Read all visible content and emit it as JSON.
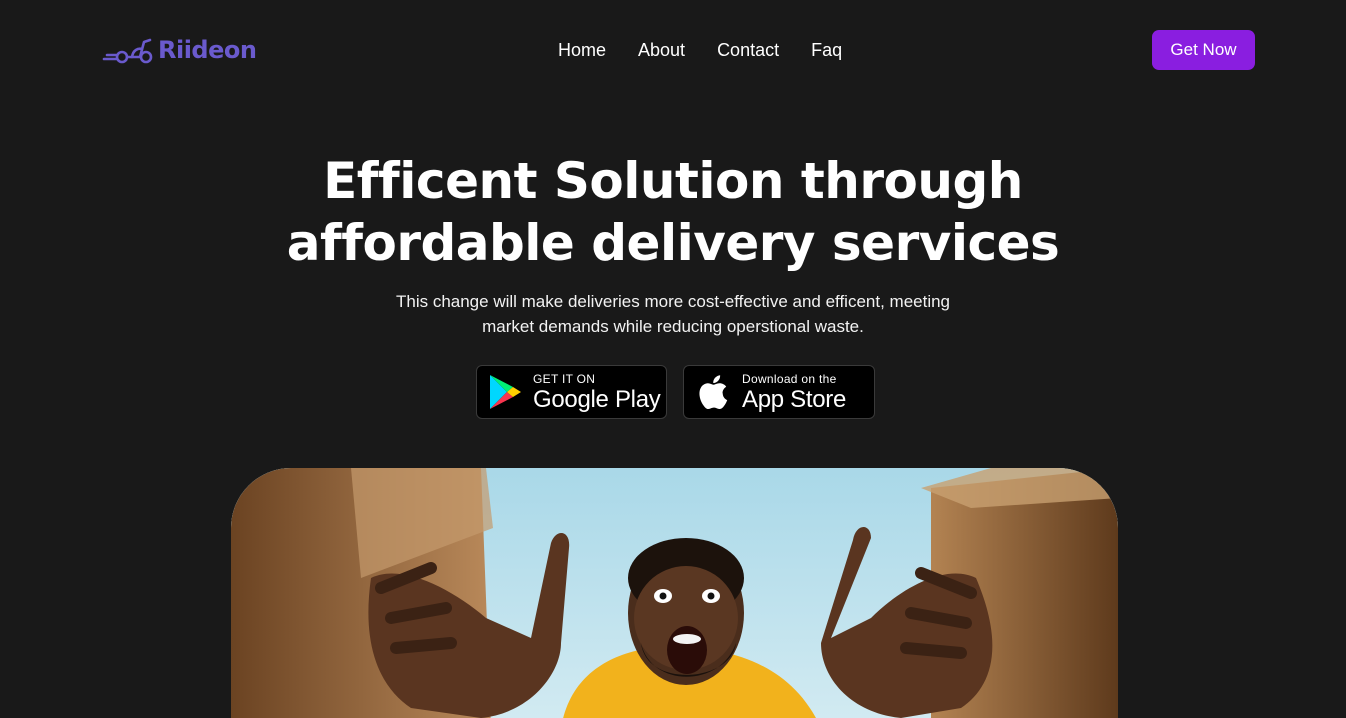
{
  "brand": {
    "name": "Riideon",
    "logo_icon": "scooter-icon",
    "accent": "#6a5acd"
  },
  "nav": {
    "items": [
      "Home",
      "About",
      "Contact",
      "Faq"
    ]
  },
  "header": {
    "cta_label": "Get Now",
    "cta_color": "#8a1ee0"
  },
  "hero": {
    "title_line1": "Efficent Solution through",
    "title_line2": "affordable delivery services",
    "subtitle_line1": "This change will make deliveries more cost-effective and efficent, meeting",
    "subtitle_line2": "market demands while reducing operstional waste."
  },
  "badges": {
    "google": {
      "small": "GET IT ON",
      "big": "Google Play",
      "icon": "google-play-icon"
    },
    "apple": {
      "small": "Download on the",
      "big": "App Store",
      "icon": "apple-icon"
    }
  },
  "colors": {
    "background": "#191919",
    "text": "#ffffff"
  }
}
